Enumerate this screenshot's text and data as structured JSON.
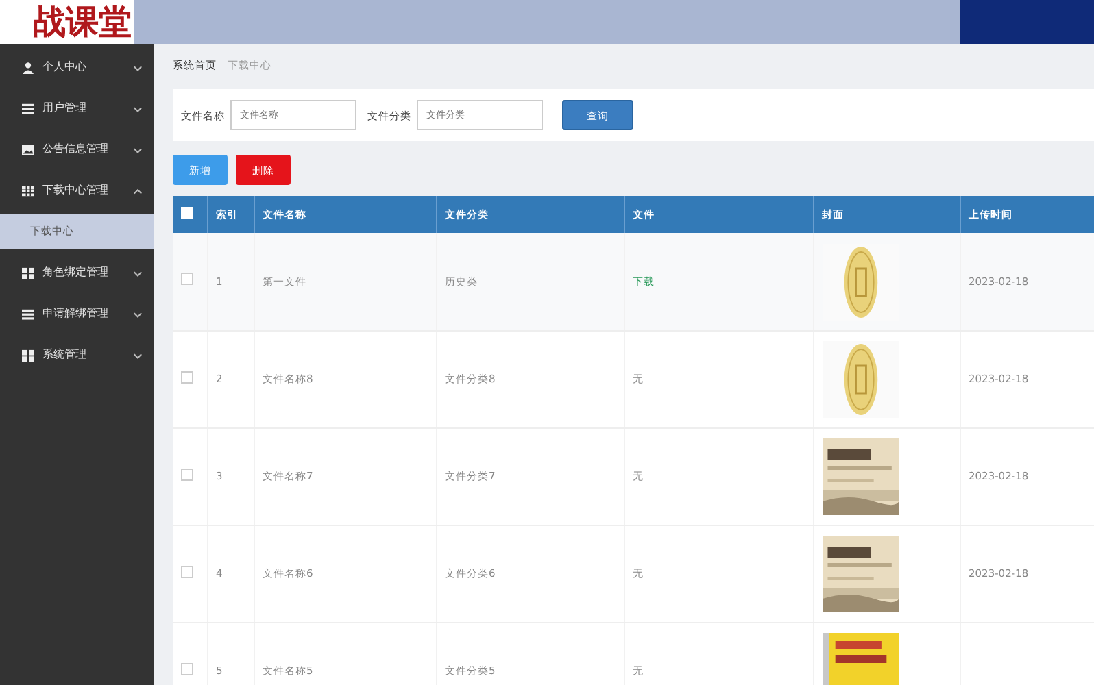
{
  "header": {
    "logo": "战课堂"
  },
  "sidebar": {
    "items": [
      {
        "label": "个人中心",
        "expanded": false
      },
      {
        "label": "用户管理",
        "expanded": false
      },
      {
        "label": "公告信息管理",
        "expanded": false
      },
      {
        "label": "下载中心管理",
        "expanded": true,
        "children": [
          {
            "label": "下载中心",
            "selected": true
          }
        ]
      },
      {
        "label": "角色绑定管理",
        "expanded": false
      },
      {
        "label": "申请解绑管理",
        "expanded": false
      },
      {
        "label": "系统管理",
        "expanded": false
      }
    ]
  },
  "breadcrumb": [
    "系统首页",
    "下载中心"
  ],
  "search": {
    "fields": [
      {
        "label": "文件名称",
        "placeholder": "文件名称"
      },
      {
        "label": "文件分类",
        "placeholder": "文件分类"
      }
    ],
    "button": "查询"
  },
  "actions": [
    {
      "label": "新增",
      "kind": "add"
    },
    {
      "label": "删除",
      "kind": "delete"
    }
  ],
  "table": {
    "header_checked": false,
    "columns": [
      "索引",
      "文件名称",
      "文件分类",
      "文件",
      "封面",
      "上传时间"
    ],
    "rows": [
      {
        "checked": false,
        "index": "1",
        "name": "第一文件",
        "category": "历史类",
        "file": {
          "text": "下载",
          "kind": "link"
        },
        "date": "2023-02-18"
      },
      {
        "checked": false,
        "index": "2",
        "name": "文件名称8",
        "category": "文件分类8",
        "file": {
          "text": "无",
          "kind": "text"
        },
        "date": "2023-02-18"
      },
      {
        "checked": false,
        "index": "3",
        "name": "文件名称7",
        "category": "文件分类7",
        "file": {
          "text": "无",
          "kind": "text"
        },
        "date": "2023-02-18"
      },
      {
        "checked": false,
        "index": "4",
        "name": "文件名称6",
        "category": "文件分类6",
        "file": {
          "text": "无",
          "kind": "text"
        },
        "date": "2023-02-18"
      },
      {
        "checked": false,
        "index": "5",
        "name": "文件名称5",
        "category": "文件分类5",
        "file": {
          "text": "无",
          "kind": "text"
        }
      }
    ]
  }
}
